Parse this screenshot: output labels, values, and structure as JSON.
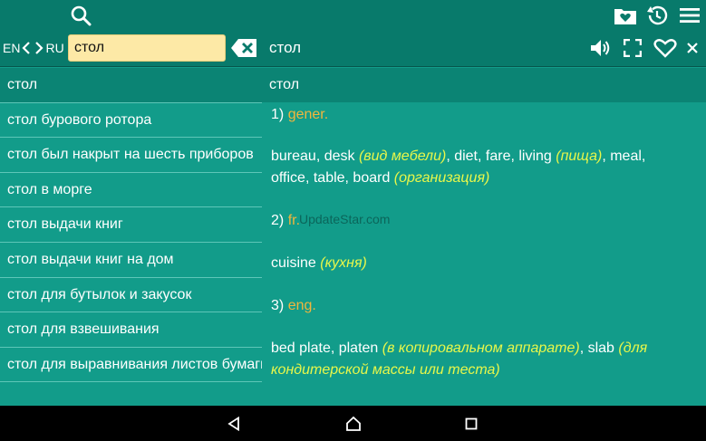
{
  "topbar": {
    "search_icon": "search-icon",
    "favorites_icon": "heart-folder-icon",
    "history_icon": "history-icon",
    "menu_icon": "menu-icon"
  },
  "lang": {
    "source": "EN",
    "target": "RU"
  },
  "search": {
    "value": "стол",
    "clear_icon": "backspace-clear-icon"
  },
  "header": {
    "word": "стол",
    "speaker_icon": "speaker-icon",
    "fullscreen_icon": "fullscreen-icon",
    "favorite_icon": "heart-icon",
    "close_icon": "close-icon"
  },
  "word_list": [
    "стол",
    "стол бурового ротора",
    "стол был накрыт на шесть приборов",
    "стол в морге",
    "стол выдачи книг",
    "стол выдачи книг на дом",
    "стол для бутылок и закусок",
    "стол для взвешивания",
    "стол для выравнивания листов бумаги"
  ],
  "detail": {
    "title": "стол",
    "senses": [
      {
        "num": "1)",
        "label": "gener.",
        "line1_a": "bureau, desk ",
        "line1_note1": "(вид мебели)",
        "line1_b": ", diet, fare, living ",
        "line1_note2": "(пища)",
        "line1_c": ", meal,",
        "line2_a": "office, table, board ",
        "line2_note": "(организация)"
      },
      {
        "num": "2)",
        "label": "fr.",
        "text": "cuisine ",
        "note": "(кухня)"
      },
      {
        "num": "3)",
        "label": "eng.",
        "line1_a": "bed plate, platen ",
        "line1_note": "(в копировальном аппарате)",
        "line1_b": ", slab ",
        "line1_note2": "(для",
        "line2_note": "кондитерской массы или теста)"
      }
    ],
    "watermark": "UpdateStar.com"
  },
  "colors": {
    "app_bg": "#129c8a",
    "topbar_bg": "#087a6b",
    "label": "#f2b63c",
    "note": "#e8f74a",
    "search_bg": "#fde9a6"
  }
}
